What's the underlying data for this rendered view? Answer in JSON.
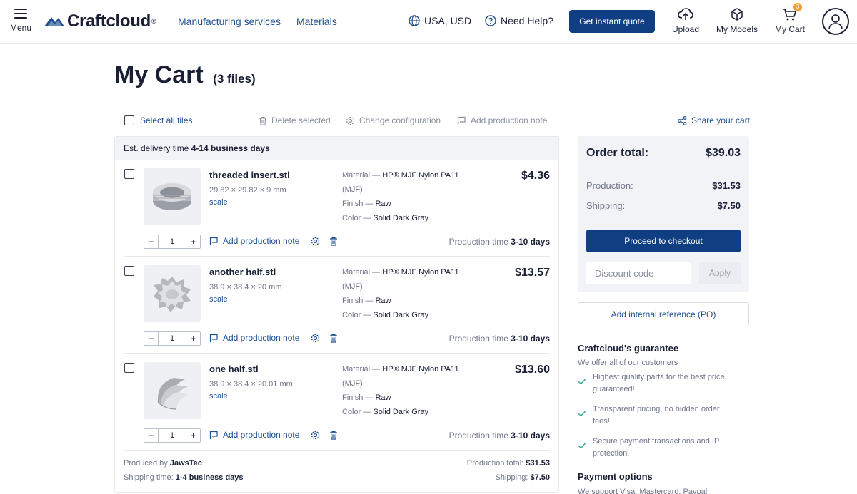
{
  "header": {
    "menu_label": "Menu",
    "logo_text": "Craftcloud",
    "logo_reg": "®",
    "nav": [
      "Manufacturing services",
      "Materials"
    ],
    "region": "USA, USD",
    "help": "Need Help?",
    "quote_button": "Get instant quote",
    "upload": "Upload",
    "my_models": "My Models",
    "my_cart": "My Cart",
    "cart_count": "3"
  },
  "page": {
    "title": "My Cart",
    "file_count": "(3 files)"
  },
  "toolbar": {
    "select_all": "Select all files",
    "delete_selected": "Delete selected",
    "change_configuration": "Change configuration",
    "add_production_note": "Add production note",
    "share_cart": "Share your cart"
  },
  "cart": {
    "delivery_prefix": "Est. delivery time ",
    "delivery_value": "4-14 business days",
    "items": [
      {
        "name": "threaded insert.stl",
        "dims": "29.82 × 29.82 × 9 mm",
        "scale": "scale",
        "material_label": "Material — ",
        "material": "HP® MJF Nylon PA11",
        "material_cont": "(MJF)",
        "finish_label": "Finish — ",
        "finish": "Raw",
        "color_label": "Color — ",
        "color": "Solid Dark Gray",
        "price": "$4.36",
        "qty": "1",
        "add_note": "Add production note",
        "prod_label": "Production time ",
        "prod_time": "3-10 days"
      },
      {
        "name": "another half.stl",
        "dims": "38.9 × 38.4 × 20 mm",
        "scale": "scale",
        "material_label": "Material — ",
        "material": "HP® MJF Nylon PA11",
        "material_cont": "(MJF)",
        "finish_label": "Finish — ",
        "finish": "Raw",
        "color_label": "Color — ",
        "color": "Solid Dark Gray",
        "price": "$13.57",
        "qty": "1",
        "add_note": "Add production note",
        "prod_label": "Production time ",
        "prod_time": "3-10 days"
      },
      {
        "name": "one half.stl",
        "dims": "38.9 × 38.4 × 20.01 mm",
        "scale": "scale",
        "material_label": "Material — ",
        "material": "HP® MJF Nylon PA11",
        "material_cont": "(MJF)",
        "finish_label": "Finish — ",
        "finish": "Raw",
        "color_label": "Color — ",
        "color": "Solid Dark Gray",
        "price": "$13.60",
        "qty": "1",
        "add_note": "Add production note",
        "prod_label": "Production time ",
        "prod_time": "3-10 days"
      }
    ],
    "footer": {
      "produced_label": "Produced by ",
      "producer": "JawsTec",
      "shipping_time_label": "Shipping time: ",
      "shipping_time": "1-4 business days",
      "production_total_label": "Production total: ",
      "production_total": "$31.53",
      "shipping_label": "Shipping: ",
      "shipping": "$7.50"
    }
  },
  "summary": {
    "title": "Order total:",
    "total": "$39.03",
    "production_label": "Production:",
    "production": "$31.53",
    "shipping_label": "Shipping:",
    "shipping": "$7.50",
    "checkout": "Proceed to checkout",
    "discount_placeholder": "Discount code",
    "apply": "Apply",
    "po_button": "Add internal reference (PO)"
  },
  "guarantee": {
    "title": "Craftcloud's guarantee",
    "subtitle": "We offer all of our customers",
    "items": [
      [
        "Highest quality parts for the best price,",
        "guaranteed!"
      ],
      [
        "Transparent pricing, no hidden order",
        "fees!"
      ],
      [
        "Secure payment transactions and IP",
        "protection."
      ]
    ]
  },
  "payment": {
    "title": "Payment options",
    "subtitle": "We support Visa, Mastercard, Paypal"
  },
  "colors": {
    "primary": "#0f3f82",
    "link": "#1d4f91",
    "text": "#1a1f36",
    "muted": "#70768a",
    "panel": "#f1f3f7",
    "badge": "#f0a030",
    "check": "#3aa88a"
  }
}
